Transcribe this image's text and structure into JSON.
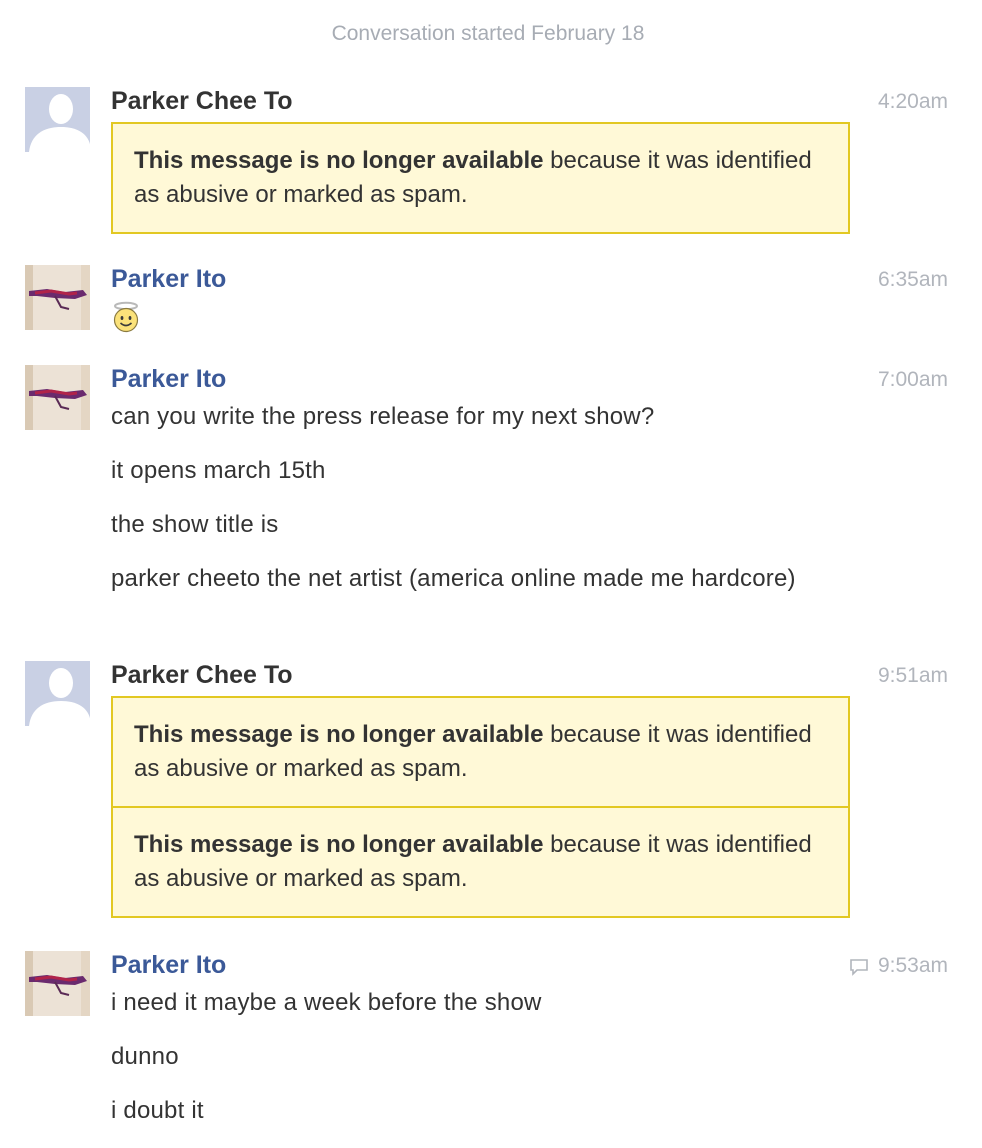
{
  "conversation": {
    "started_label": "Conversation started February 18"
  },
  "notice": {
    "bold": "This message is no longer available",
    "rest": " because it was identified as abusive or marked as spam."
  },
  "groups": [
    {
      "author": "Parker Chee To",
      "time": "4:20am"
    },
    {
      "author": "Parker Ito",
      "time": "6:35am",
      "emoji": "angel-smiley"
    },
    {
      "author": "Parker Ito",
      "time": "7:00am",
      "messages": [
        "can you write the press release for my next show?",
        "it opens march 15th",
        "the show title is",
        "parker cheeto the net artist (america online made me hardcore)"
      ]
    },
    {
      "author": "Parker Chee To",
      "time": "9:51am"
    },
    {
      "author": "Parker Ito",
      "time": "9:53am",
      "messages": [
        "i need it maybe a week before the show",
        "dunno",
        "i doubt it"
      ]
    }
  ],
  "colors": {
    "link_blue": "#3b5998",
    "notice_bg": "#fff9d7",
    "notice_border": "#e2c822",
    "timestamp": "#b1b5bc"
  }
}
